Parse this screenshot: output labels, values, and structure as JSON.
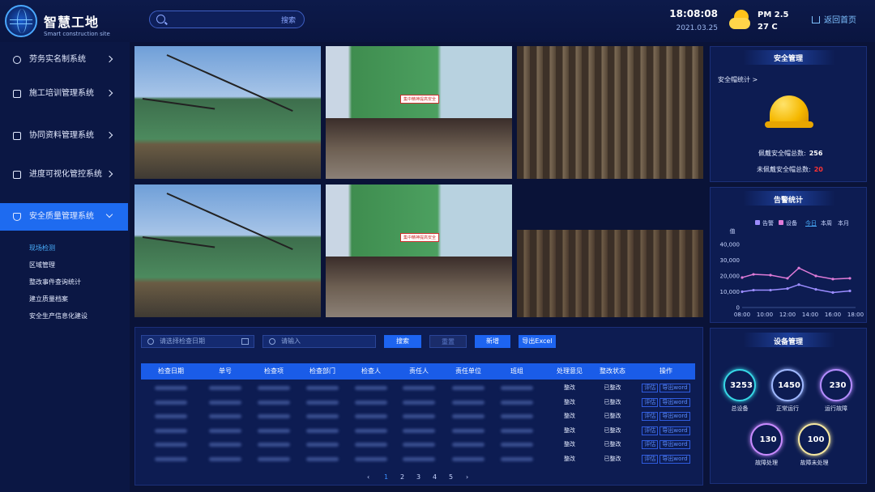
{
  "header": {
    "title": "智慧工地",
    "subtitle": "Smart construction site",
    "search_button": "搜索",
    "time": "18:08:08",
    "date": "2021.03.25",
    "pm_label": "PM 2.5",
    "temperature": "27 C",
    "home_link": "返回首页"
  },
  "sidebar": {
    "items": [
      {
        "label": "劳务实名制系统",
        "icon": "user-icon"
      },
      {
        "label": "施工培训管理系统",
        "icon": "person-icon"
      },
      {
        "label": "协同资料管理系统",
        "icon": "book-icon"
      },
      {
        "label": "进度可视化管控系统",
        "icon": "hourglass-icon"
      },
      {
        "label": "安全质量管理系统",
        "icon": "shield-icon",
        "active": true
      }
    ],
    "subitems": [
      {
        "label": "现场检测",
        "active": true
      },
      {
        "label": "区域管理"
      },
      {
        "label": "整改事件查询统计"
      },
      {
        "label": "建立质量档案"
      },
      {
        "label": "安全生产信息化建设"
      }
    ]
  },
  "photos": {
    "sign_text": "集中精神提高安全"
  },
  "inspection": {
    "date_placeholder": "请选择检查日期",
    "input_placeholder": "请输入",
    "search_button": "搜索",
    "reset_button": "重置",
    "add_button": "新增",
    "export_button": "导出Excel",
    "columns": [
      "检查日期",
      "单号",
      "检查项",
      "检查部门",
      "检查人",
      "责任人",
      "责任单位",
      "班组",
      "处理意见",
      "整改状态",
      "操作"
    ],
    "rows": [
      {
        "opinion": "整改",
        "status": "已整改"
      },
      {
        "opinion": "整改",
        "status": "已整改"
      },
      {
        "opinion": "整改",
        "status": "已整改"
      },
      {
        "opinion": "整改",
        "status": "已整改"
      },
      {
        "opinion": "整改",
        "status": "已整改"
      },
      {
        "opinion": "整改",
        "status": "已整改"
      }
    ],
    "row_actions": [
      "评估",
      "导出word"
    ],
    "pages": [
      "1",
      "2",
      "3",
      "4",
      "5"
    ],
    "current_page": "1",
    "prev_icon": "chevron-left-icon",
    "next_icon": "chevron-right-icon"
  },
  "safety": {
    "title": "安全管理",
    "helmet_stats_link": "安全帽统计 >",
    "wearing_label": "佩戴安全帽总数:",
    "wearing_value": "256",
    "not_wearing_label": "未佩戴安全帽总数:",
    "not_wearing_value": "20",
    "not_wearing_color": "#ff3333"
  },
  "alarms": {
    "title": "告警统计",
    "legend": [
      {
        "name": "告警",
        "color": "#9b8cff"
      },
      {
        "name": "设备",
        "color": "#e07bd8"
      }
    ],
    "periods": [
      "今日",
      "本周",
      "本月"
    ],
    "active_period": "今日"
  },
  "chart_data": {
    "type": "line",
    "ylabel": "值",
    "x": [
      "08:00",
      "10:00",
      "12:00",
      "14:00",
      "16:00",
      "18:00"
    ],
    "ylim": [
      0,
      40000
    ],
    "yticks": [
      "0",
      "10,000",
      "20,000",
      "30,000",
      "40,000"
    ],
    "xticks": [
      "08:00",
      "10:00",
      "12:00",
      "14:00",
      "16:00",
      "18:00"
    ],
    "series": [
      {
        "name": "告警",
        "color": "#9b8cff",
        "x": [
          8,
          9,
          10.5,
          12,
          13,
          14.5,
          16,
          17.5
        ],
        "values": [
          10000,
          11000,
          11000,
          12000,
          14500,
          11500,
          9500,
          10500
        ]
      },
      {
        "name": "设备",
        "color": "#e07bd8",
        "x": [
          8,
          9,
          10.5,
          12,
          13,
          14.5,
          16,
          17.5
        ],
        "values": [
          19000,
          21000,
          20500,
          18500,
          25000,
          20000,
          18000,
          18500
        ]
      }
    ],
    "grid": false,
    "legend_position": "top"
  },
  "devices": {
    "title": "设备管理",
    "items": [
      {
        "value": "3253",
        "label": "总设备",
        "color": "#36d7e6"
      },
      {
        "value": "1450",
        "label": "正常运行",
        "color": "#9fb8ff"
      },
      {
        "value": "230",
        "label": "运行故障",
        "color": "#b48cff"
      },
      {
        "value": "130",
        "label": "故障处理",
        "color": "#c98bff"
      },
      {
        "value": "100",
        "label": "故障未处理",
        "color": "#f5e7a0"
      }
    ]
  }
}
